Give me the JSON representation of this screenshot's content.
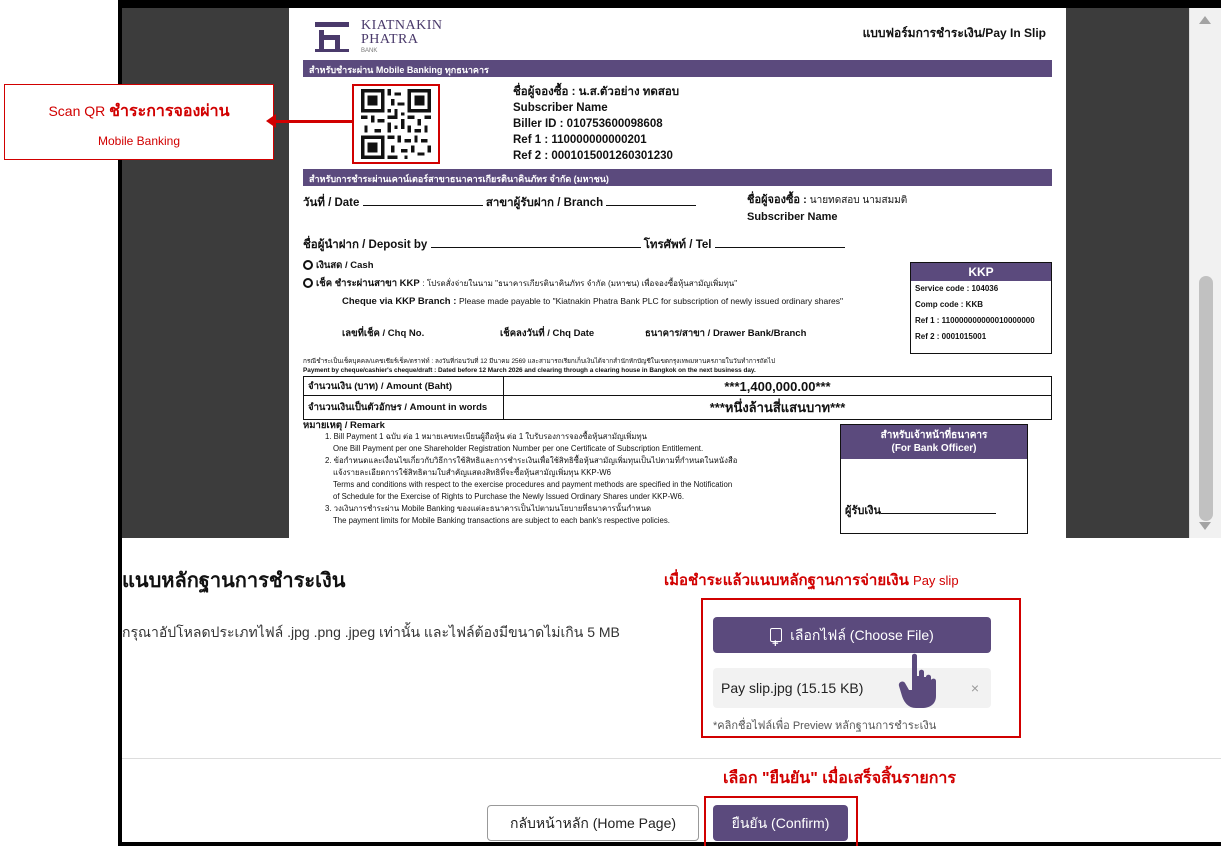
{
  "slip": {
    "bank_name_line1": "KIATNAKIN",
    "bank_name_line2": "PHATRA",
    "bank_name_line3": "BANK",
    "form_title": "แบบฟอร์มการชำระเงิน/Pay In Slip",
    "band_mobile": "สำหรับชำระผ่าน Mobile Banking ทุกธนาคาร",
    "subscriber_label": "ชื่อผู้จองซื้อ :",
    "subscriber_value": "น.ส.ตัวอย่าง ทดสอบ",
    "subscriber_name_en": "Subscriber Name",
    "biller_id": "Biller ID : 010753600098608",
    "ref1_label": "Ref 1 :",
    "ref1_value": "110000000000201",
    "ref2_label": "Ref 2 :",
    "ref2_value": "0001015001260301230",
    "band_counter": "สำหรับการชำระผ่านเคาน์เตอร์สาขาธนาคารเกียรตินาคินภัทร จำกัด (มหาชน)",
    "date_label": "วันที่ / Date",
    "branch_label": "สาขาผู้รับฝาก / Branch",
    "subscriber2_label": "ชื่อผู้จองซื้อ :",
    "subscriber2_value": "นายทดสอบ นามสมมติ",
    "subscriber2_name_en": "Subscriber Name",
    "deposit_label": "ชื่อผู้นำฝาก / Deposit by",
    "tel_label": "โทรศัพท์ / Tel",
    "cash_label": "เงินสด / Cash",
    "cheque_label": "เช็ค ชำระผ่านสาขา KKP",
    "cheque_note_th": ": โปรดสั่งจ่ายในนาม \"ธนาคารเกียรตินาคินภัทร จำกัด (มหาชน) เพื่อจองซื้อหุ้นสามัญเพิ่มทุน\"",
    "cheque_en_label": "Cheque via KKP Branch :",
    "cheque_en_text": "Please made payable to \"Kiatnakin Phatra Bank PLC for subscription of newly issued ordinary shares\"",
    "chq_no": "เลขที่เช็ค / Chq No.",
    "chq_date": "เช็คลงวันที่ / Chq Date",
    "drawer_bank": "ธนาคาร/สาขา / Drawer Bank/Branch",
    "kkp_head": "KKP",
    "service_code": "Service code : 104036",
    "comp_code": "Comp code   : KKB",
    "kkp_ref1": "Ref 1 : 110000000000010000000",
    "kkp_ref2": "Ref 2 : 0001015001",
    "fine_th": "กรณีชำระเป็นเช็คบุคคล/แคชเชียร์เช็ค/ดราฟท์ : ลงวันที่ก่อนวันที่ 12 มีนาคม 2569 และสามารถเรียกเก็บเงินได้จากสำนักหักบัญชีในเขตกรุงเทพมหานครภายในวันทำการถัดไป",
    "fine_en": "Payment by cheque/cashier's cheque/draft : Dated before 12 March 2026 and clearing through a clearing house in Bangkok on the next business day.",
    "amount_label": "จำนวนเงิน (บาท) / Amount (Baht)",
    "amount_value": "***1,400,000.00***",
    "words_label": "จำนวนเงินเป็นตัวอักษร / Amount in words",
    "words_value": "***หนึ่งล้านสี่แสนบาท***",
    "remark_title": "หมายเหตุ / Remark",
    "remark_1_th": "1. Bill Payment 1 ฉบับ ต่อ 1 หมายเลขทะเบียนผู้ถือหุ้น ต่อ 1 ใบรับรองการจองซื้อหุ้นสามัญเพิ่มทุน",
    "remark_1_en": "One Bill Payment per one Shareholder Registration Number per one Certificate of Subscription Entitlement.",
    "remark_2_th": "2. ข้อกำหนดและเงื่อนไขเกี่ยวกับวิธีการใช้สิทธิและการชำระเงินเพื่อใช้สิทธิซื้อหุ้นสามัญเพิ่มทุนเป็นไปตามที่กำหนดในหนังสือ",
    "remark_2_th2": "แจ้งรายละเอียดการใช้สิทธิตามใบสำคัญแสดงสิทธิที่จะซื้อหุ้นสามัญเพิ่มทุน KKP-W6",
    "remark_2_en": "Terms and conditions with respect to the exercise procedures and payment methods are specified in the Notification",
    "remark_2_en2": "of Schedule for the Exercise of Rights to Purchase the Newly Issued Ordinary Shares under KKP-W6.",
    "remark_3_th": "3. วงเงินการชำระผ่าน Mobile Banking ของแต่ละธนาคารเป็นไปตามนโยบายที่ธนาคารนั้นกำหนด",
    "remark_3_en": "The payment limits for Mobile Banking transactions are subject to each bank's respective policies.",
    "officer_th": "สำหรับเจ้าหน้าที่ธนาคาร",
    "officer_en": "(For Bank Officer)",
    "officer_sign": "ผู้รับเงิน"
  },
  "annotations": {
    "scan_qr_prefix": "Scan QR",
    "scan_qr_main": "ชำระการจองผ่าน",
    "scan_qr_sub": "Mobile Banking",
    "paid_note": "เมื่อชำระแล้วแนบหลักฐานการจ่ายเงิน",
    "paid_note_small": "Pay slip",
    "confirm_note": "เลือก \"ยืนยัน\" เมื่อเสร็จสิ้นรายการ"
  },
  "upload": {
    "section_title": "แนบหลักฐานการชำระเงิน",
    "hint": "กรุณาอัปโหลดประเภทไฟล์ .jpg .png .jpeg เท่านั้น และไฟล์ต้องมีขนาดไม่เกิน 5 MB",
    "choose_label": "เลือกไฟล์ (Choose File)",
    "file_name": "Pay slip.jpg (15.15 KB)",
    "remove_symbol": "×",
    "preview_hint": "*คลิกชื่อไฟล์เพื่อ Preview หลักฐานการชำระเงิน"
  },
  "actions": {
    "home_label": "กลับหน้าหลัก (Home Page)",
    "confirm_label": "ยืนยัน (Confirm)"
  },
  "colors": {
    "accent": "#5b4a7d",
    "annotation_red": "#d10000"
  }
}
